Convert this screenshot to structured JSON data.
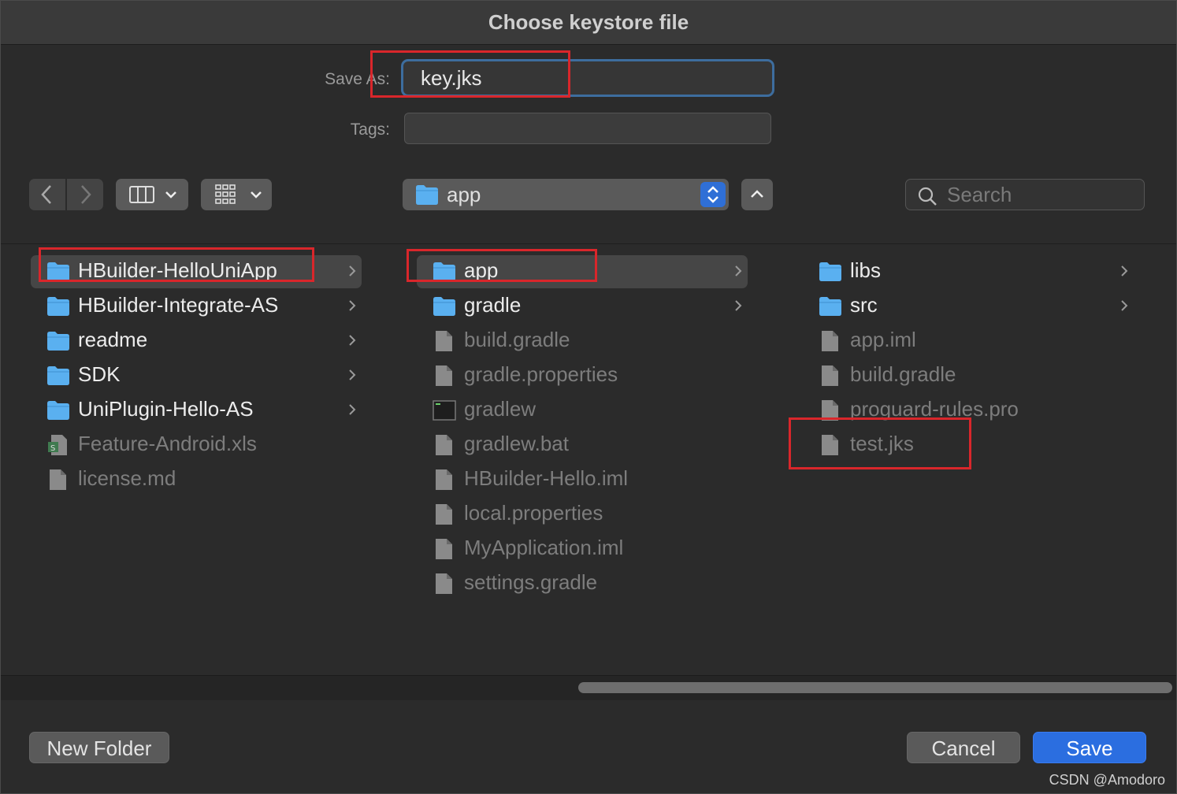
{
  "window": {
    "title": "Choose keystore file"
  },
  "form": {
    "save_as_label": "Save As:",
    "save_as_value": "key.jks",
    "tags_label": "Tags:",
    "tags_value": ""
  },
  "toolbar": {
    "location": "app",
    "search_placeholder": "Search",
    "back_icon": "chevron-left-icon",
    "forward_icon": "chevron-right-icon",
    "view_icon": "column-view-icon",
    "group_icon": "grid-group-icon"
  },
  "columns": [
    {
      "items": [
        {
          "name": "HBuilder-HelloUniApp",
          "kind": "folder",
          "selected": true
        },
        {
          "name": "HBuilder-Integrate-AS",
          "kind": "folder"
        },
        {
          "name": "readme",
          "kind": "folder"
        },
        {
          "name": "SDK",
          "kind": "folder"
        },
        {
          "name": "UniPlugin-Hello-AS",
          "kind": "folder"
        },
        {
          "name": "Feature-Android.xls",
          "kind": "sheet"
        },
        {
          "name": "license.md",
          "kind": "file"
        }
      ]
    },
    {
      "items": [
        {
          "name": "app",
          "kind": "folder",
          "selected": true
        },
        {
          "name": "gradle",
          "kind": "folder"
        },
        {
          "name": "build.gradle",
          "kind": "file"
        },
        {
          "name": "gradle.properties",
          "kind": "file"
        },
        {
          "name": "gradlew",
          "kind": "exec"
        },
        {
          "name": "gradlew.bat",
          "kind": "file"
        },
        {
          "name": "HBuilder-Hello.iml",
          "kind": "file"
        },
        {
          "name": "local.properties",
          "kind": "file"
        },
        {
          "name": "MyApplication.iml",
          "kind": "file"
        },
        {
          "name": "settings.gradle",
          "kind": "file"
        }
      ]
    },
    {
      "items": [
        {
          "name": "libs",
          "kind": "folder"
        },
        {
          "name": "src",
          "kind": "folder"
        },
        {
          "name": "app.iml",
          "kind": "file"
        },
        {
          "name": "build.gradle",
          "kind": "file"
        },
        {
          "name": "proguard-rules.pro",
          "kind": "file"
        },
        {
          "name": "test.jks",
          "kind": "file"
        }
      ]
    }
  ],
  "footer": {
    "new_folder": "New Folder",
    "cancel": "Cancel",
    "save": "Save"
  },
  "watermark": "CSDN @Amodoro",
  "colors": {
    "accent": "#2b6ee0",
    "folder": "#5ab0f0",
    "highlight_box": "#d9262b"
  }
}
